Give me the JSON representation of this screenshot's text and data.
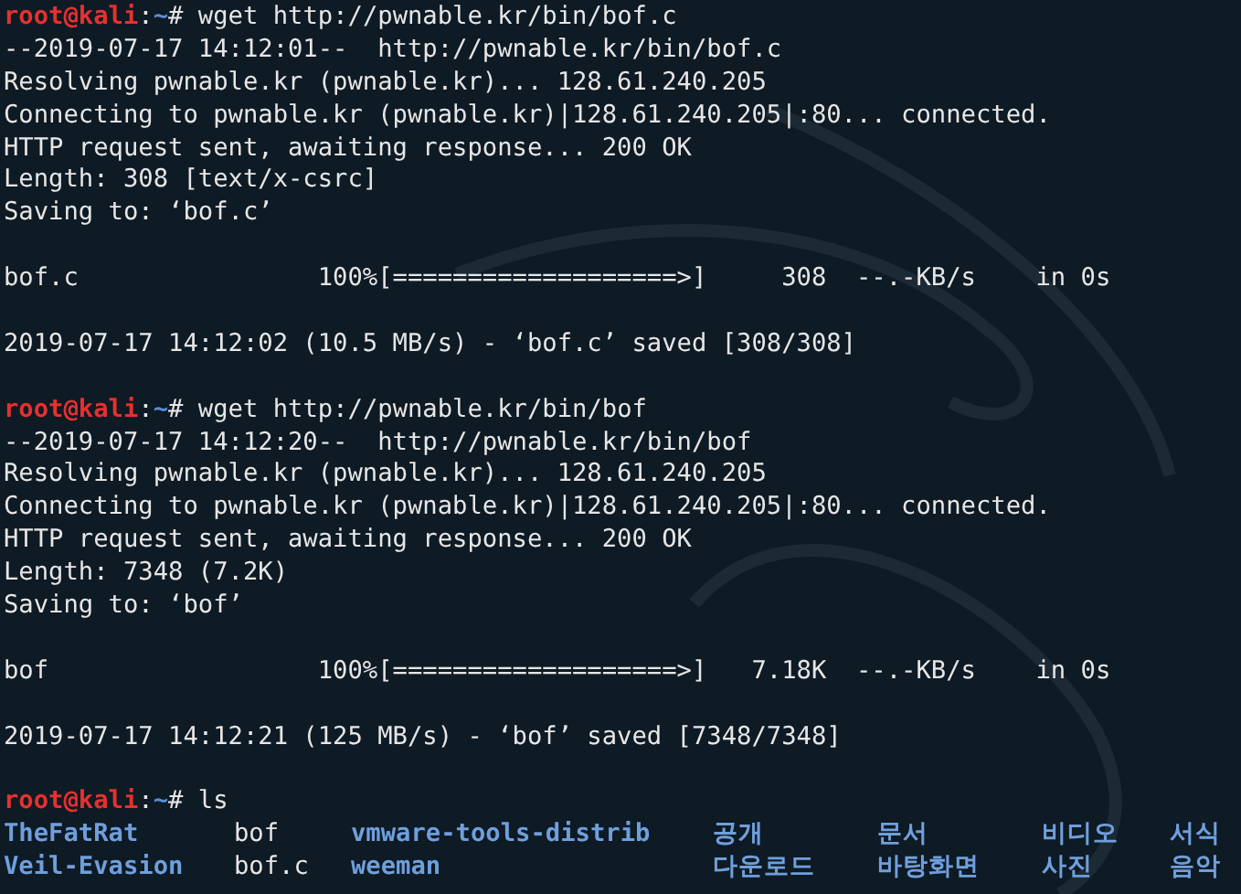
{
  "terminal": {
    "lines": [
      {
        "kind": "prompt",
        "user": "root@kali",
        "separator": ":",
        "path": "~",
        "symbol": "#",
        "command": "wget http://pwnable.kr/bin/bof.c"
      },
      {
        "kind": "output",
        "text": "--2019-07-17 14:12:01--  http://pwnable.kr/bin/bof.c"
      },
      {
        "kind": "output",
        "text": "Resolving pwnable.kr (pwnable.kr)... 128.61.240.205"
      },
      {
        "kind": "output",
        "text": "Connecting to pwnable.kr (pwnable.kr)|128.61.240.205|:80... connected."
      },
      {
        "kind": "output",
        "text": "HTTP request sent, awaiting response... 200 OK"
      },
      {
        "kind": "output",
        "text": "Length: 308 [text/x-csrc]"
      },
      {
        "kind": "output",
        "text": "Saving to: ‘bof.c’"
      },
      {
        "kind": "blank"
      },
      {
        "kind": "progress",
        "text": "bof.c                100%[===================>]     308  --.-KB/s    in 0s"
      },
      {
        "kind": "blank"
      },
      {
        "kind": "output",
        "text": "2019-07-17 14:12:02 (10.5 MB/s) - ‘bof.c’ saved [308/308]"
      },
      {
        "kind": "blank"
      },
      {
        "kind": "prompt",
        "user": "root@kali",
        "separator": ":",
        "path": "~",
        "symbol": "#",
        "command": "wget http://pwnable.kr/bin/bof"
      },
      {
        "kind": "output",
        "text": "--2019-07-17 14:12:20--  http://pwnable.kr/bin/bof"
      },
      {
        "kind": "output",
        "text": "Resolving pwnable.kr (pwnable.kr)... 128.61.240.205"
      },
      {
        "kind": "output",
        "text": "Connecting to pwnable.kr (pwnable.kr)|128.61.240.205|:80... connected."
      },
      {
        "kind": "output",
        "text": "HTTP request sent, awaiting response... 200 OK"
      },
      {
        "kind": "output",
        "text": "Length: 7348 (7.2K)"
      },
      {
        "kind": "output",
        "text": "Saving to: ‘bof’"
      },
      {
        "kind": "blank"
      },
      {
        "kind": "progress",
        "text": "bof                  100%[===================>]   7.18K  --.-KB/s    in 0s"
      },
      {
        "kind": "blank"
      },
      {
        "kind": "output",
        "text": "2019-07-17 14:12:21 (125 MB/s) - ‘bof’ saved [7348/7348]"
      },
      {
        "kind": "blank"
      },
      {
        "kind": "prompt",
        "user": "root@kali",
        "separator": ":",
        "path": "~",
        "symbol": "#",
        "command": "ls"
      },
      {
        "kind": "listing",
        "rows": [
          [
            {
              "name": "TheFatRat",
              "kind": "dir"
            },
            {
              "name": "bof",
              "kind": "file"
            },
            {
              "name": "vmware-tools-distrib",
              "kind": "dir"
            },
            {
              "name": "공개",
              "kind": "dir"
            },
            {
              "name": "문서",
              "kind": "dir"
            },
            {
              "name": "비디오",
              "kind": "dir"
            },
            {
              "name": "서식",
              "kind": "dir"
            }
          ],
          [
            {
              "name": "Veil-Evasion",
              "kind": "dir"
            },
            {
              "name": "bof.c",
              "kind": "file"
            },
            {
              "name": "weeman",
              "kind": "dir"
            },
            {
              "name": "다운로드",
              "kind": "dir"
            },
            {
              "name": "바탕화면",
              "kind": "dir"
            },
            {
              "name": "사진",
              "kind": "dir"
            },
            {
              "name": "음악",
              "kind": "dir"
            }
          ]
        ]
      }
    ]
  }
}
